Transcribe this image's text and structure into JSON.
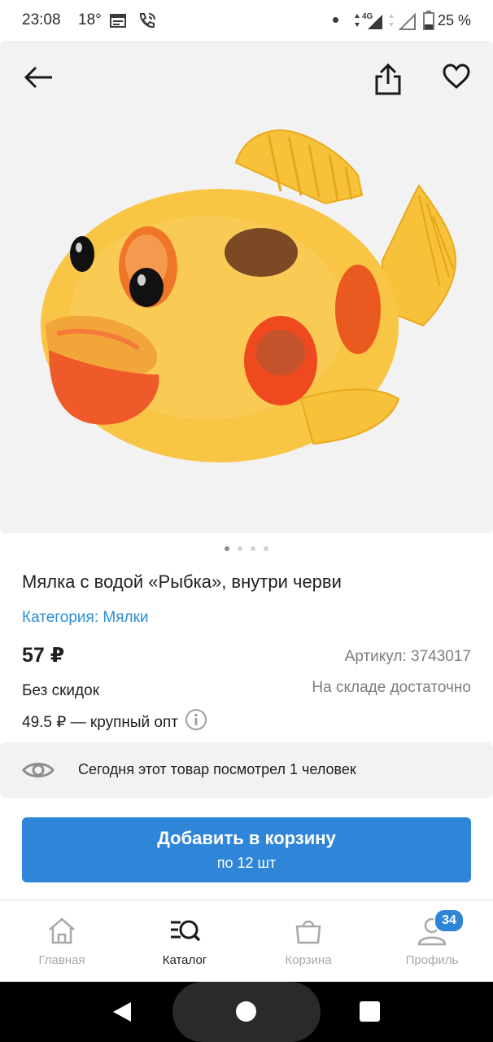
{
  "status_bar": {
    "time": "23:08",
    "temperature": "18°",
    "network": "4G",
    "battery": "25 %"
  },
  "product": {
    "title": "Мялка с водой «Рыбка», внутри черви",
    "category": "Категория: Мялки",
    "price": "57 ₽",
    "sku": "Артикул: 3743017",
    "discount": "Без скидок",
    "stock": "На складе достаточно",
    "wholesale": "49.5 ₽ — крупный опт",
    "image_pages": 4,
    "image_page_active": 1
  },
  "views_notice": "Сегодня этот товар посмотрел 1 человек",
  "cart_button": {
    "label": "Добавить в корзину",
    "sub": "по 12 шт"
  },
  "nav": {
    "home": "Главная",
    "catalog": "Каталог",
    "cart": "Корзина",
    "profile": "Профиль",
    "profile_badge": "34"
  },
  "colors": {
    "accent": "#2f86d9",
    "link": "#2d8fd6",
    "panel": "#f2f2f2"
  }
}
